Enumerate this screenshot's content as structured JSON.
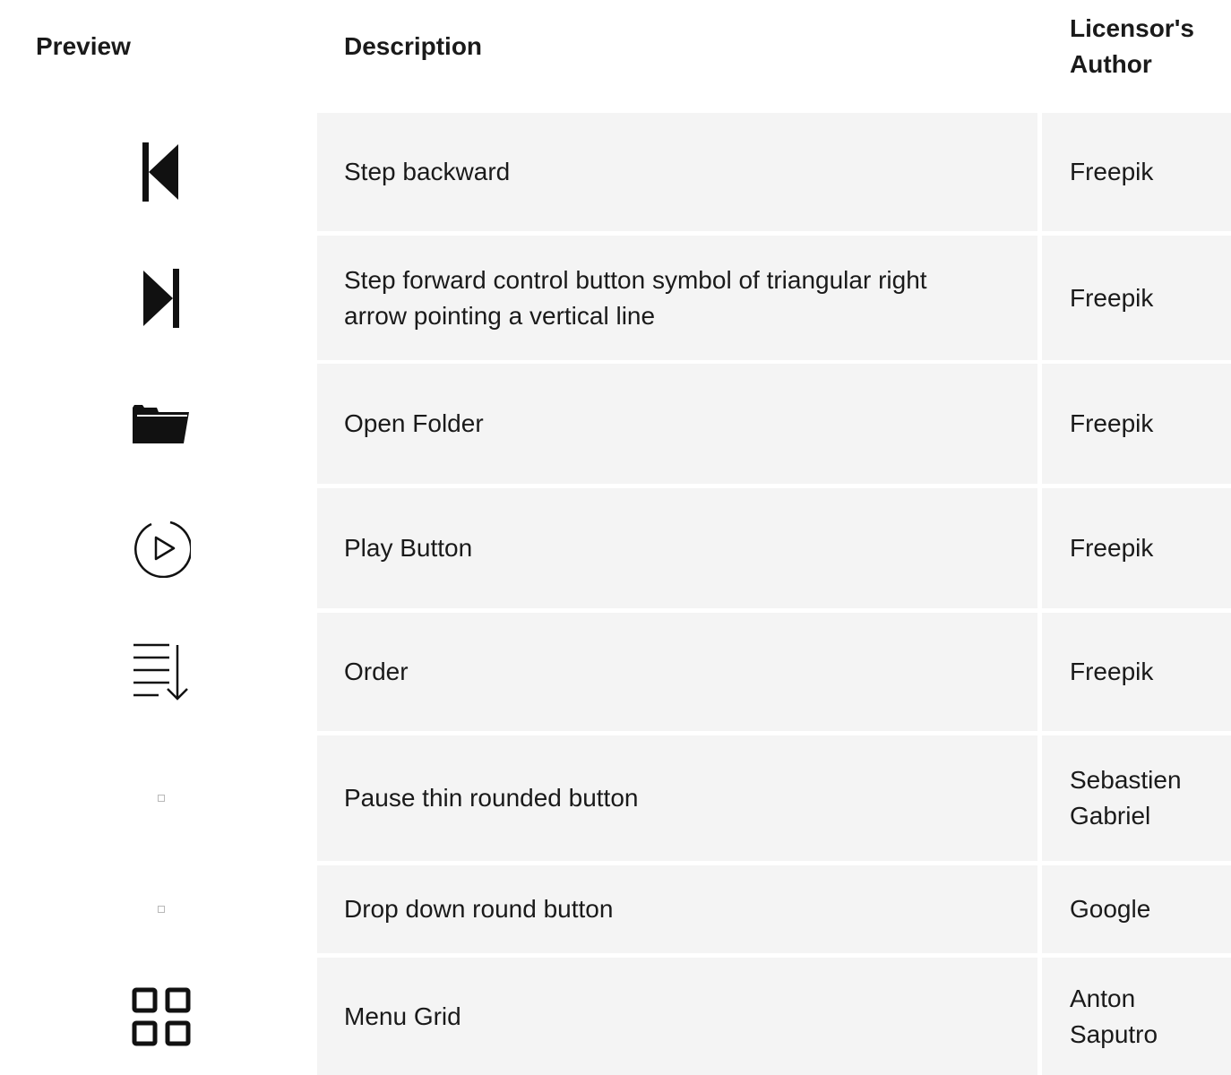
{
  "header": {
    "preview": "Preview",
    "description": "Description",
    "author": "Licensor's Author"
  },
  "rows": [
    {
      "icon": "step-backward-icon",
      "description": "Step backward",
      "author": "Freepik"
    },
    {
      "icon": "step-forward-icon",
      "description": "Step forward control button symbol of triangular right arrow pointing a vertical line",
      "author": "Freepik"
    },
    {
      "icon": "open-folder-icon",
      "description": "Open Folder",
      "author": "Freepik"
    },
    {
      "icon": "play-button-icon",
      "description": "Play Button",
      "author": "Freepik"
    },
    {
      "icon": "order-icon",
      "description": "Order",
      "author": "Freepik"
    },
    {
      "icon": "broken-image-icon",
      "description": "Pause thin rounded button",
      "author": "Sebastien Gabriel"
    },
    {
      "icon": "broken-image-icon",
      "description": "Drop down round button",
      "author": "Google"
    },
    {
      "icon": "menu-grid-icon",
      "description": "Menu Grid",
      "author": "Anton Saputro"
    }
  ],
  "colors": {
    "cell_background": "#f4f4f4",
    "text": "#1a1a1a",
    "icon": "#111111"
  }
}
